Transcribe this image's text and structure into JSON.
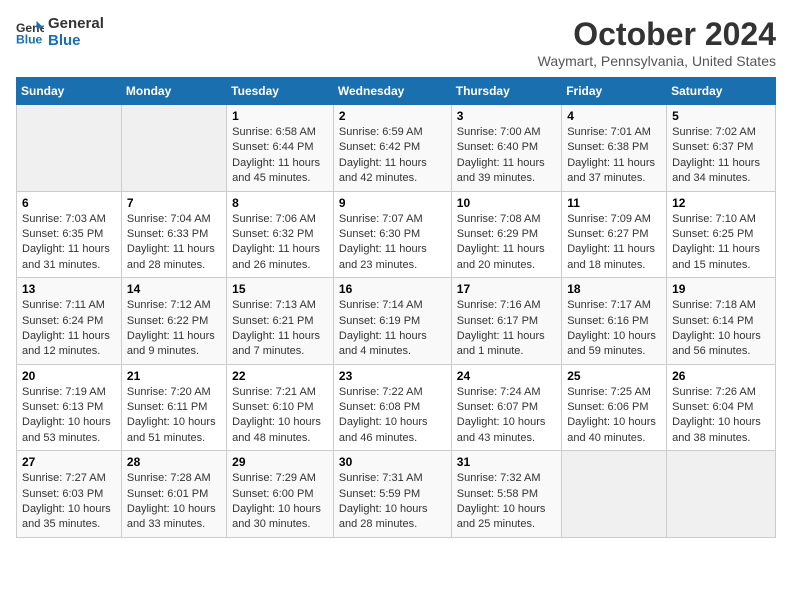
{
  "logo": {
    "line1": "General",
    "line2": "Blue"
  },
  "title": "October 2024",
  "location": "Waymart, Pennsylvania, United States",
  "days_of_week": [
    "Sunday",
    "Monday",
    "Tuesday",
    "Wednesday",
    "Thursday",
    "Friday",
    "Saturday"
  ],
  "weeks": [
    [
      {
        "num": "",
        "sunrise": "",
        "sunset": "",
        "daylight": ""
      },
      {
        "num": "",
        "sunrise": "",
        "sunset": "",
        "daylight": ""
      },
      {
        "num": "1",
        "sunrise": "Sunrise: 6:58 AM",
        "sunset": "Sunset: 6:44 PM",
        "daylight": "Daylight: 11 hours and 45 minutes."
      },
      {
        "num": "2",
        "sunrise": "Sunrise: 6:59 AM",
        "sunset": "Sunset: 6:42 PM",
        "daylight": "Daylight: 11 hours and 42 minutes."
      },
      {
        "num": "3",
        "sunrise": "Sunrise: 7:00 AM",
        "sunset": "Sunset: 6:40 PM",
        "daylight": "Daylight: 11 hours and 39 minutes."
      },
      {
        "num": "4",
        "sunrise": "Sunrise: 7:01 AM",
        "sunset": "Sunset: 6:38 PM",
        "daylight": "Daylight: 11 hours and 37 minutes."
      },
      {
        "num": "5",
        "sunrise": "Sunrise: 7:02 AM",
        "sunset": "Sunset: 6:37 PM",
        "daylight": "Daylight: 11 hours and 34 minutes."
      }
    ],
    [
      {
        "num": "6",
        "sunrise": "Sunrise: 7:03 AM",
        "sunset": "Sunset: 6:35 PM",
        "daylight": "Daylight: 11 hours and 31 minutes."
      },
      {
        "num": "7",
        "sunrise": "Sunrise: 7:04 AM",
        "sunset": "Sunset: 6:33 PM",
        "daylight": "Daylight: 11 hours and 28 minutes."
      },
      {
        "num": "8",
        "sunrise": "Sunrise: 7:06 AM",
        "sunset": "Sunset: 6:32 PM",
        "daylight": "Daylight: 11 hours and 26 minutes."
      },
      {
        "num": "9",
        "sunrise": "Sunrise: 7:07 AM",
        "sunset": "Sunset: 6:30 PM",
        "daylight": "Daylight: 11 hours and 23 minutes."
      },
      {
        "num": "10",
        "sunrise": "Sunrise: 7:08 AM",
        "sunset": "Sunset: 6:29 PM",
        "daylight": "Daylight: 11 hours and 20 minutes."
      },
      {
        "num": "11",
        "sunrise": "Sunrise: 7:09 AM",
        "sunset": "Sunset: 6:27 PM",
        "daylight": "Daylight: 11 hours and 18 minutes."
      },
      {
        "num": "12",
        "sunrise": "Sunrise: 7:10 AM",
        "sunset": "Sunset: 6:25 PM",
        "daylight": "Daylight: 11 hours and 15 minutes."
      }
    ],
    [
      {
        "num": "13",
        "sunrise": "Sunrise: 7:11 AM",
        "sunset": "Sunset: 6:24 PM",
        "daylight": "Daylight: 11 hours and 12 minutes."
      },
      {
        "num": "14",
        "sunrise": "Sunrise: 7:12 AM",
        "sunset": "Sunset: 6:22 PM",
        "daylight": "Daylight: 11 hours and 9 minutes."
      },
      {
        "num": "15",
        "sunrise": "Sunrise: 7:13 AM",
        "sunset": "Sunset: 6:21 PM",
        "daylight": "Daylight: 11 hours and 7 minutes."
      },
      {
        "num": "16",
        "sunrise": "Sunrise: 7:14 AM",
        "sunset": "Sunset: 6:19 PM",
        "daylight": "Daylight: 11 hours and 4 minutes."
      },
      {
        "num": "17",
        "sunrise": "Sunrise: 7:16 AM",
        "sunset": "Sunset: 6:17 PM",
        "daylight": "Daylight: 11 hours and 1 minute."
      },
      {
        "num": "18",
        "sunrise": "Sunrise: 7:17 AM",
        "sunset": "Sunset: 6:16 PM",
        "daylight": "Daylight: 10 hours and 59 minutes."
      },
      {
        "num": "19",
        "sunrise": "Sunrise: 7:18 AM",
        "sunset": "Sunset: 6:14 PM",
        "daylight": "Daylight: 10 hours and 56 minutes."
      }
    ],
    [
      {
        "num": "20",
        "sunrise": "Sunrise: 7:19 AM",
        "sunset": "Sunset: 6:13 PM",
        "daylight": "Daylight: 10 hours and 53 minutes."
      },
      {
        "num": "21",
        "sunrise": "Sunrise: 7:20 AM",
        "sunset": "Sunset: 6:11 PM",
        "daylight": "Daylight: 10 hours and 51 minutes."
      },
      {
        "num": "22",
        "sunrise": "Sunrise: 7:21 AM",
        "sunset": "Sunset: 6:10 PM",
        "daylight": "Daylight: 10 hours and 48 minutes."
      },
      {
        "num": "23",
        "sunrise": "Sunrise: 7:22 AM",
        "sunset": "Sunset: 6:08 PM",
        "daylight": "Daylight: 10 hours and 46 minutes."
      },
      {
        "num": "24",
        "sunrise": "Sunrise: 7:24 AM",
        "sunset": "Sunset: 6:07 PM",
        "daylight": "Daylight: 10 hours and 43 minutes."
      },
      {
        "num": "25",
        "sunrise": "Sunrise: 7:25 AM",
        "sunset": "Sunset: 6:06 PM",
        "daylight": "Daylight: 10 hours and 40 minutes."
      },
      {
        "num": "26",
        "sunrise": "Sunrise: 7:26 AM",
        "sunset": "Sunset: 6:04 PM",
        "daylight": "Daylight: 10 hours and 38 minutes."
      }
    ],
    [
      {
        "num": "27",
        "sunrise": "Sunrise: 7:27 AM",
        "sunset": "Sunset: 6:03 PM",
        "daylight": "Daylight: 10 hours and 35 minutes."
      },
      {
        "num": "28",
        "sunrise": "Sunrise: 7:28 AM",
        "sunset": "Sunset: 6:01 PM",
        "daylight": "Daylight: 10 hours and 33 minutes."
      },
      {
        "num": "29",
        "sunrise": "Sunrise: 7:29 AM",
        "sunset": "Sunset: 6:00 PM",
        "daylight": "Daylight: 10 hours and 30 minutes."
      },
      {
        "num": "30",
        "sunrise": "Sunrise: 7:31 AM",
        "sunset": "Sunset: 5:59 PM",
        "daylight": "Daylight: 10 hours and 28 minutes."
      },
      {
        "num": "31",
        "sunrise": "Sunrise: 7:32 AM",
        "sunset": "Sunset: 5:58 PM",
        "daylight": "Daylight: 10 hours and 25 minutes."
      },
      {
        "num": "",
        "sunrise": "",
        "sunset": "",
        "daylight": ""
      },
      {
        "num": "",
        "sunrise": "",
        "sunset": "",
        "daylight": ""
      }
    ]
  ]
}
